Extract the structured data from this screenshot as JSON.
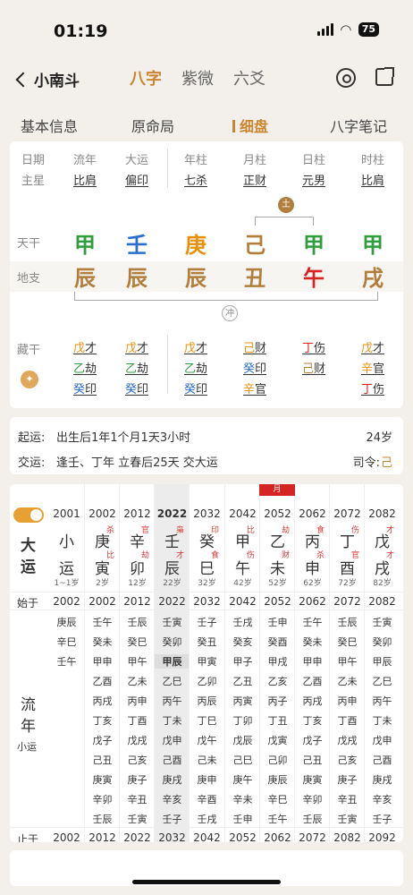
{
  "status": {
    "time": "01:19",
    "battery": "75"
  },
  "nav": {
    "back": "小南斗",
    "tabs": [
      "八字",
      "紫微",
      "六爻"
    ],
    "active": 0
  },
  "subtabs": {
    "items": [
      "基本信息",
      "原命局",
      "细盘",
      "八字笔记"
    ],
    "active": 2
  },
  "pillars": {
    "headers": [
      "日期",
      "流年",
      "大运",
      "年柱",
      "月柱",
      "日柱",
      "时柱"
    ],
    "stars": [
      "主星",
      "比肩",
      "偏印",
      "七杀",
      "正财",
      "元男",
      "比肩"
    ],
    "tiangan_label": "天干",
    "dizhi_label": "地支",
    "canggan_label": "藏干",
    "gan": [
      "甲",
      "壬",
      "庚",
      "己",
      "甲",
      "甲"
    ],
    "gan_colors": [
      "#2e9e3e",
      "#2a6fc9",
      "#e8900a",
      "#b07e3d",
      "#2e9e3e",
      "#2e9e3e"
    ],
    "zhi": [
      "辰",
      "辰",
      "辰",
      "丑",
      "午",
      "戌"
    ],
    "zhi_colors": [
      "#b07e3d",
      "#b07e3d",
      "#b07e3d",
      "#b07e3d",
      "#d82323",
      "#b07e3d"
    ],
    "he_label": "土",
    "chong_label": "冲",
    "canggan": [
      [
        [
          "戊",
          "才",
          "#e8900a"
        ],
        [
          "乙",
          "劫",
          "#2e9e3e"
        ],
        [
          "癸",
          "印",
          "#2a6fc9"
        ]
      ],
      [
        [
          "戊",
          "才",
          "#e8900a"
        ],
        [
          "乙",
          "劫",
          "#2e9e3e"
        ],
        [
          "癸",
          "印",
          "#2a6fc9"
        ]
      ],
      [
        [
          "戊",
          "才",
          "#e8900a"
        ],
        [
          "乙",
          "劫",
          "#2e9e3e"
        ],
        [
          "癸",
          "印",
          "#2a6fc9"
        ]
      ],
      [
        [
          "己",
          "财",
          "#e8900a"
        ],
        [
          "癸",
          "印",
          "#2a6fc9"
        ],
        [
          "辛",
          "官",
          "#e8900a"
        ]
      ],
      [
        [
          "丁",
          "伤",
          "#d82323"
        ],
        [
          "己",
          "财",
          "#b07e3d"
        ]
      ],
      [
        [
          "戊",
          "才",
          "#e8900a"
        ],
        [
          "辛",
          "官",
          "#e8900a"
        ],
        [
          "丁",
          "伤",
          "#d82323"
        ]
      ]
    ]
  },
  "yun": {
    "qiyun_label": "起运:",
    "qiyun": "出生后1年1个月1天3小时",
    "qiyun_age": "24岁",
    "jiaoyun_label": "交运:",
    "jiaoyun": "逢壬、丁年 立春后25天 交大运",
    "siling_label": "司令:",
    "siling": "己"
  },
  "dayun": {
    "title1": "大",
    "title2": "运",
    "liunian_label1": "流",
    "liunian_label2": "年",
    "xiaoyun_label": "小运",
    "start_label": "始于",
    "end_label": "止于",
    "month_tag": "月",
    "cols": [
      {
        "year": "2001",
        "gan": "小",
        "zhi": "运",
        "age": "1~1岁",
        "gsup": "",
        "zsup": "",
        "gc": "#333",
        "zc": "#333",
        "start": "2002",
        "end": "2002",
        "ln": [
          "庚辰",
          "辛巳",
          "壬午"
        ]
      },
      {
        "year": "2002",
        "gan": "庚",
        "zhi": "寅",
        "age": "2岁",
        "gsup": "杀",
        "zsup": "比",
        "gc": "#333",
        "zc": "#333",
        "start": "2002",
        "end": "2012",
        "ln": [
          "壬午",
          "癸未",
          "甲申",
          "乙酉",
          "丙戌",
          "丁亥",
          "戊子",
          "己丑",
          "庚寅",
          "辛卯",
          "壬辰"
        ]
      },
      {
        "year": "2012",
        "gan": "辛",
        "zhi": "卯",
        "age": "12岁",
        "gsup": "官",
        "zsup": "劫",
        "gc": "#333",
        "zc": "#333",
        "start": "2012",
        "end": "2022",
        "ln": [
          "壬辰",
          "癸巳",
          "甲午",
          "乙未",
          "丙申",
          "丁酉",
          "戊戌",
          "己亥",
          "庚子",
          "辛丑",
          "壬寅"
        ]
      },
      {
        "year": "2022",
        "gan": "壬",
        "zhi": "辰",
        "age": "22岁",
        "gsup": "枭",
        "zsup": "才",
        "gc": "#333",
        "zc": "#333",
        "start": "2022",
        "end": "2032",
        "ln": [
          "壬寅",
          "癸卯",
          "甲辰",
          "乙巳",
          "丙午",
          "丁未",
          "戊申",
          "己酉",
          "庚戌",
          "辛亥",
          "壬子"
        ]
      },
      {
        "year": "2032",
        "gan": "癸",
        "zhi": "巳",
        "age": "32岁",
        "gsup": "印",
        "zsup": "食",
        "gc": "#333",
        "zc": "#333",
        "start": "2032",
        "end": "2042",
        "ln": [
          "壬子",
          "癸丑",
          "甲寅",
          "乙卯",
          "丙辰",
          "丁巳",
          "戊午",
          "己未",
          "庚申",
          "辛酉",
          "壬戌"
        ]
      },
      {
        "year": "2042",
        "gan": "甲",
        "zhi": "午",
        "age": "42岁",
        "gsup": "比",
        "zsup": "伤",
        "gc": "#333",
        "zc": "#333",
        "start": "2042",
        "end": "2052",
        "ln": [
          "壬戌",
          "癸亥",
          "甲子",
          "乙丑",
          "丙寅",
          "丁卯",
          "戊辰",
          "己巳",
          "庚午",
          "辛未",
          "壬申"
        ]
      },
      {
        "year": "2052",
        "gan": "乙",
        "zhi": "未",
        "age": "52岁",
        "gsup": "劫",
        "zsup": "财",
        "gc": "#333",
        "zc": "#333",
        "start": "2052",
        "end": "2062",
        "ln": [
          "壬申",
          "癸酉",
          "甲戌",
          "乙亥",
          "丙子",
          "丁丑",
          "戊寅",
          "己卯",
          "庚辰",
          "辛巳",
          "壬午"
        ]
      },
      {
        "year": "2062",
        "gan": "丙",
        "zhi": "申",
        "age": "62岁",
        "gsup": "食",
        "zsup": "杀",
        "gc": "#333",
        "zc": "#333",
        "start": "2062",
        "end": "2072",
        "ln": [
          "壬午",
          "癸未",
          "甲申",
          "乙酉",
          "丙戌",
          "丁亥",
          "戊子",
          "己丑",
          "庚寅",
          "辛卯",
          "壬辰"
        ]
      },
      {
        "year": "2072",
        "gan": "丁",
        "zhi": "酉",
        "age": "72岁",
        "gsup": "伤",
        "zsup": "官",
        "gc": "#333",
        "zc": "#333",
        "start": "2072",
        "end": "2082",
        "ln": [
          "壬辰",
          "癸巳",
          "甲午",
          "乙未",
          "丙申",
          "丁酉",
          "戊戌",
          "己亥",
          "庚子",
          "辛丑",
          "壬寅"
        ]
      },
      {
        "year": "2082",
        "gan": "戊",
        "zhi": "戌",
        "age": "82岁",
        "gsup": "才",
        "zsup": "才",
        "gc": "#333",
        "zc": "#333",
        "start": "2082",
        "end": "2092",
        "ln": [
          "壬寅",
          "癸卯",
          "甲辰",
          "乙巳",
          "丙午",
          "丁未",
          "戊申",
          "己酉",
          "庚戌",
          "辛亥",
          "壬子"
        ]
      }
    ]
  }
}
